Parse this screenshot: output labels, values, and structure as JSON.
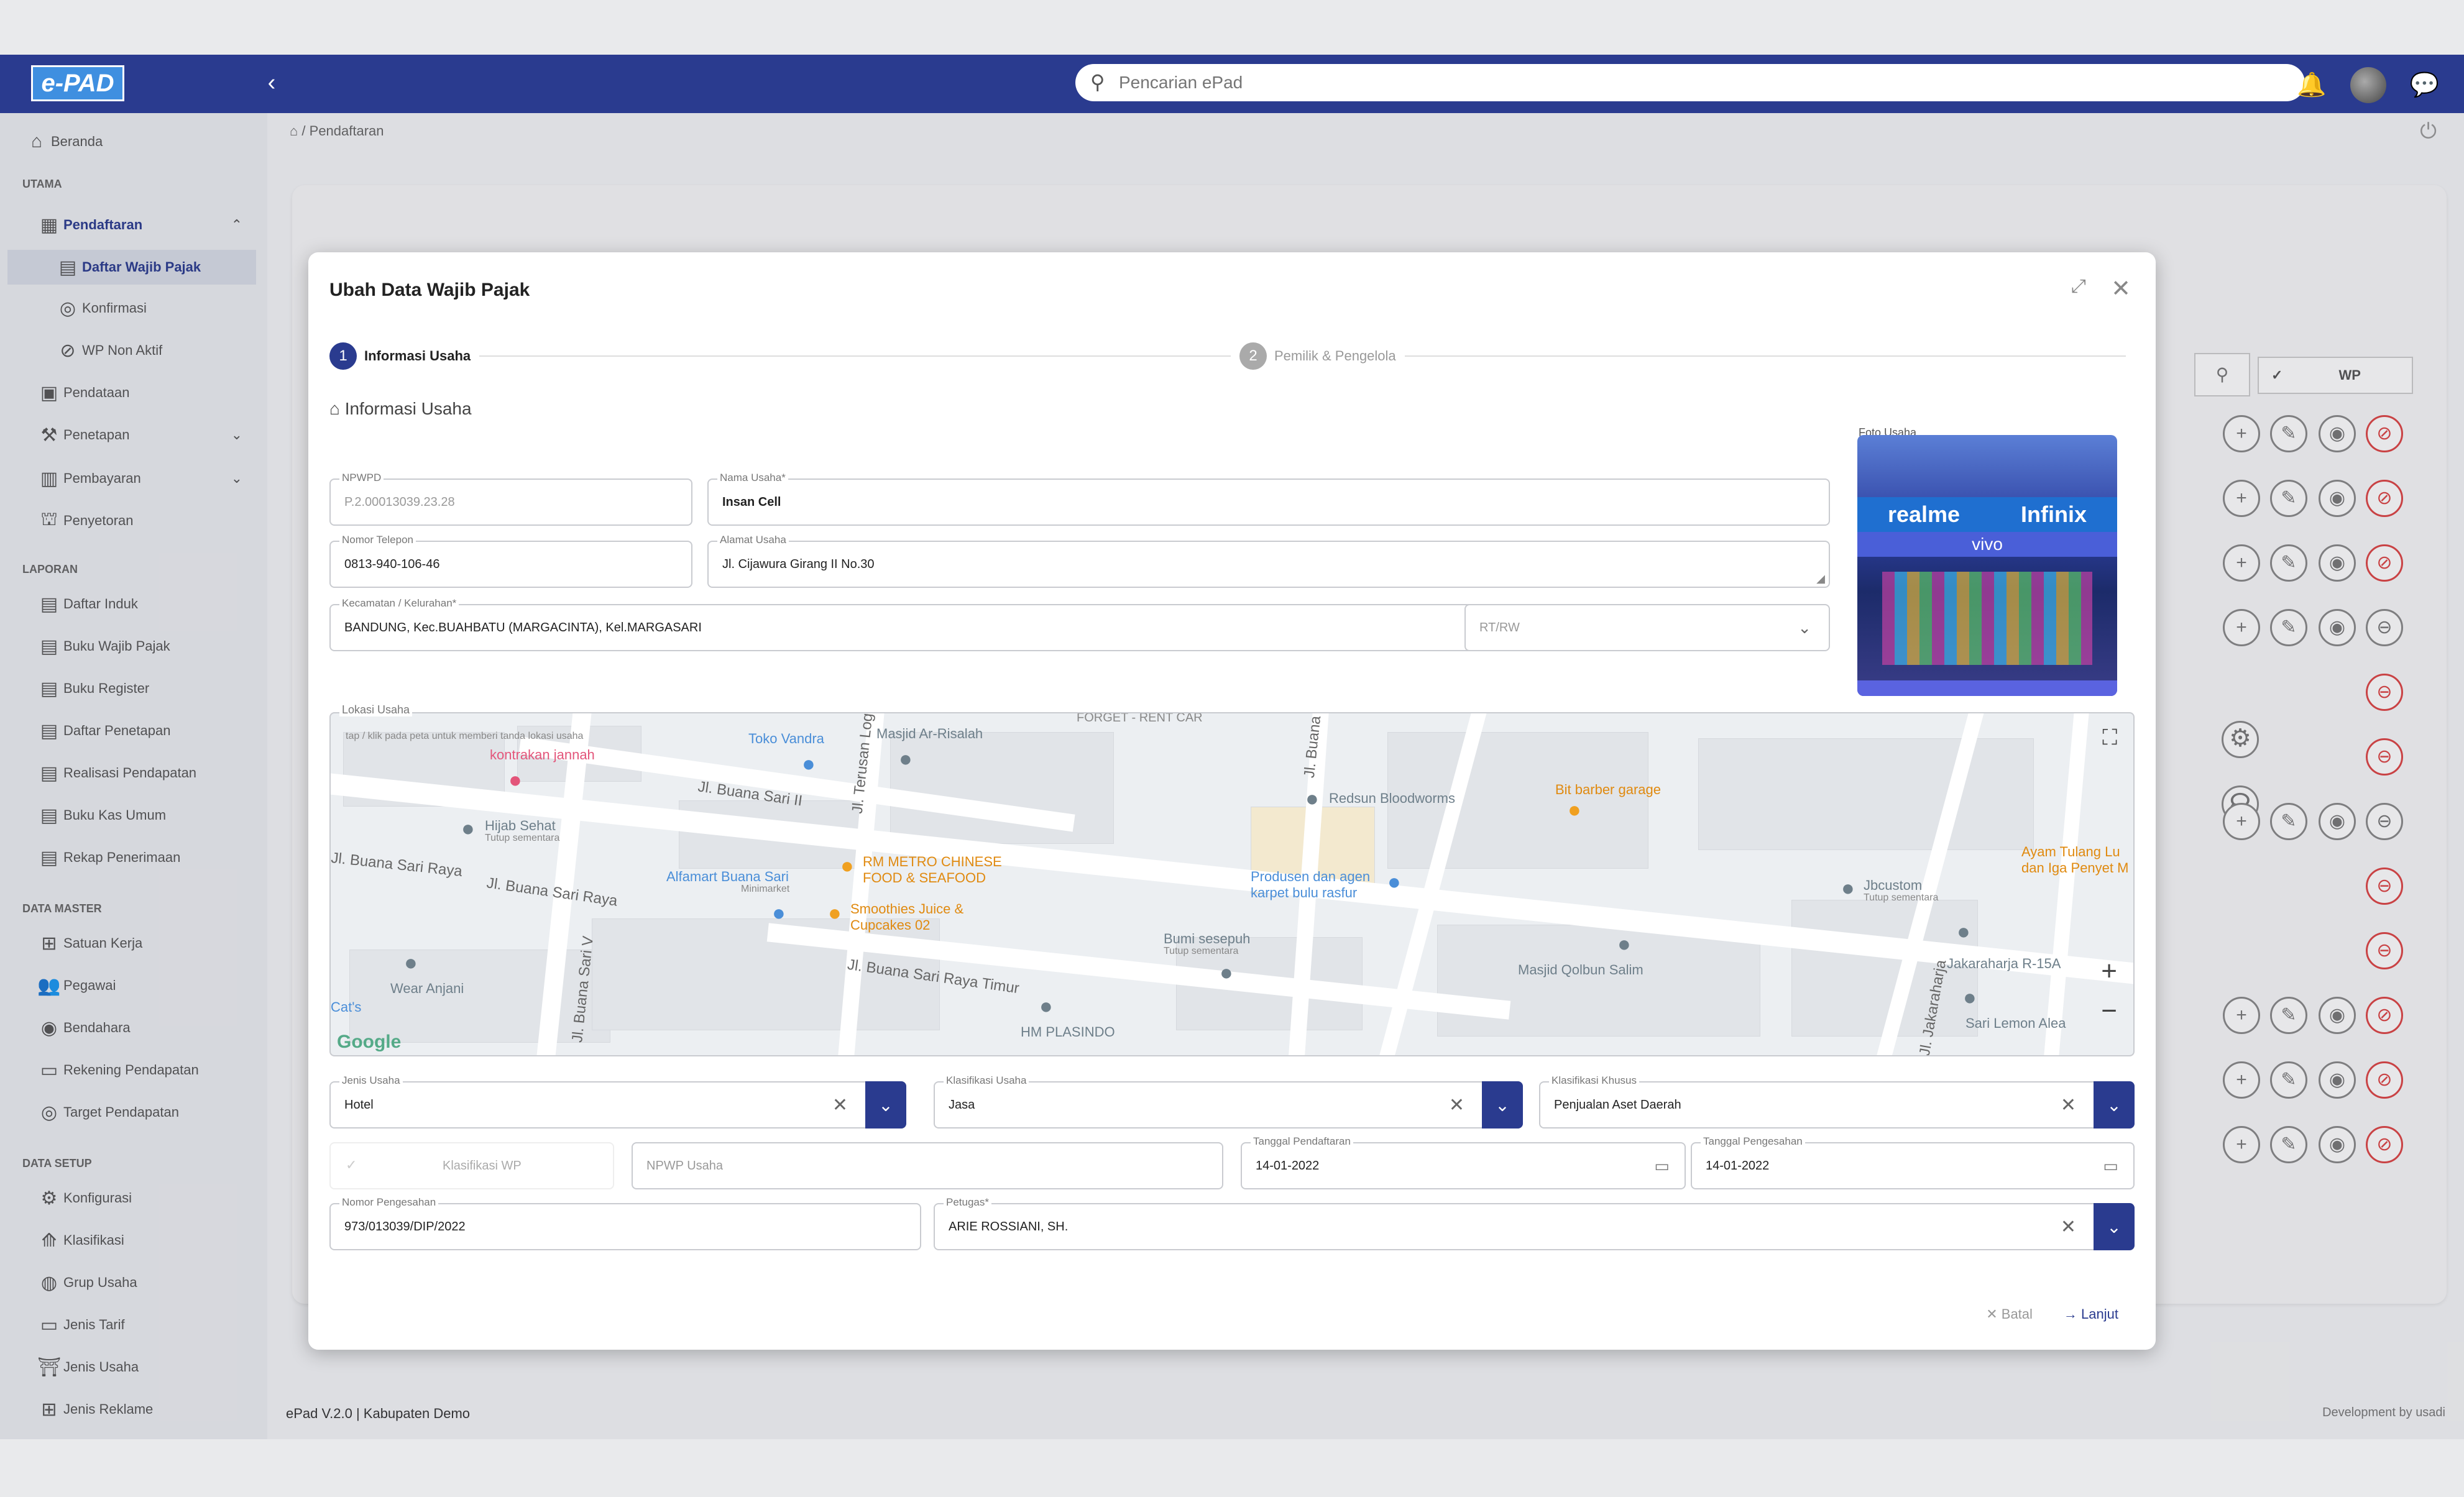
{
  "app": {
    "logo": "e-PAD",
    "search_placeholder": "Pencarian ePad"
  },
  "topbar": {
    "collapse": "‹",
    "bell": "🔔",
    "chat": "💬"
  },
  "sidebar": {
    "home": "Beranda",
    "sec_utama": "UTAMA",
    "pendaftaran": "Pendaftaran",
    "daftar_wajib_pajak": "Daftar Wajib Pajak",
    "konfirmasi": "Konfirmasi",
    "wp_non_aktif": "WP Non Aktif",
    "pendataan": "Pendataan",
    "penetapan": "Penetapan",
    "pembayaran": "Pembayaran",
    "penyetoran": "Penyetoran",
    "sec_laporan": "LAPORAN",
    "daftar_induk": "Daftar Induk",
    "buku_wajib_pajak": "Buku Wajib Pajak",
    "buku_register": "Buku Register",
    "daftar_penetapan": "Daftar Penetapan",
    "realisasi_pendapatan": "Realisasi Pendapatan",
    "buku_kas_umum": "Buku Kas Umum",
    "rekap_penerimaan": "Rekap Penerimaan",
    "sec_data_master": "DATA MASTER",
    "satuan_kerja": "Satuan Kerja",
    "pegawai": "Pegawai",
    "bendahara": "Bendahara",
    "rekening_pendapatan": "Rekening Pendapatan",
    "target_pendapatan": "Target Pendapatan",
    "sec_data_setup": "DATA SETUP",
    "konfigurasi": "Konfigurasi",
    "klasifikasi": "Klasifikasi",
    "grup_usaha": "Grup Usaha",
    "jenis_tarif": "Jenis Tarif",
    "jenis_usaha": "Jenis Usaha",
    "jenis_reklame": "Jenis Reklame"
  },
  "breadcrumb": "Pendaftaran",
  "background": {
    "wp_label": "WP"
  },
  "footer": {
    "version": "ePad V.2.0 | Kabupaten Demo",
    "dev": "Development by usadi"
  },
  "modal": {
    "title": "Ubah Data Wajib Pajak",
    "step1_num": "1",
    "step1": "Informasi Usaha",
    "step2_num": "2",
    "step2": "Pemilik & Pengelola",
    "section_title": "Informasi Usaha",
    "npwpd": {
      "label": "NPWPD",
      "value": "P.2.00013039.23.28"
    },
    "nama_usaha": {
      "label": "Nama Usaha*",
      "value": "Insan Cell"
    },
    "nomor_telepon": {
      "label": "Nomor Telepon",
      "value": "0813-940-106-46"
    },
    "alamat_usaha": {
      "label": "Alamat Usaha",
      "value": "Jl. Cijawura Girang II No.30"
    },
    "kecamatan": {
      "label": "Kecamatan / Kelurahan*",
      "value": "BANDUNG, Kec.BUAHBATU (MARGACINTA), Kel.MARGASARI"
    },
    "rt_rw": {
      "placeholder": "RT/RW"
    },
    "foto_label": "Foto Usaha",
    "photo_signs": {
      "realme": "realme",
      "infinix": "Infinix",
      "vivo": "vivo"
    },
    "lokasi_label": "Lokasi Usaha",
    "map": {
      "hint": "tap / klik pada peta untuk memberi tanda lokasi usaha",
      "places": {
        "kontrakan": "kontrakan jannah",
        "toko_vandra": "Toko Vandra",
        "masjid_ar": "Masjid Ar-Risalah",
        "forget_rent": "FORGET - RENT CAR",
        "redsun": "Redsun Bloodworms",
        "bit_barber": "Bit barber garage",
        "hijab": "Hijab Sehat",
        "hijab_sub": "Tutup sementara",
        "alfamart": "Alfamart Buana Sari",
        "alfamart_sub": "Minimarket",
        "rm_metro": "RM METRO CHINESE FOOD & SEAFOOD",
        "smoothies": "Smoothies Juice & Cupcakes 02",
        "produsen": "Produsen dan agen karpet bulu rasfur",
        "bumi": "Bumi sesepuh",
        "bumi_sub": "Tutup sementara",
        "masjid_qolbun": "Masjid Qolbun Salim",
        "jbcustom": "Jbcustom",
        "jbcustom_sub": "Tutup sementara",
        "ayam": "Ayam Tulang Lu dan Iga Penyet M",
        "jakarta": "Jakaraharja R-15A",
        "sari_lemon": "Sari Lemon Alea",
        "hm": "HM PLASINDO",
        "wear": "Wear Anjani",
        "cats": "Cat's"
      },
      "streets": {
        "s1": "Jl. Buana Sari II",
        "s2": "Jl. Buana Sari Raya",
        "s3": "Jl. Buana Sari Raya",
        "s4": "Jl. Buana Sari Raya Timur",
        "s5": "Jl. Buana Sari V",
        "s6": "Jl. Terusan Logam",
        "s7": "Jl. Buana",
        "s8": "Jl. Jakaraharja"
      },
      "google": "Google",
      "zoom_in": "+",
      "zoom_out": "−",
      "fullscreen": "⛶"
    },
    "jenis_usaha": {
      "label": "Jenis Usaha",
      "value": "Hotel"
    },
    "klasifikasi_usaha": {
      "label": "Klasifikasi Usaha",
      "value": "Jasa"
    },
    "klasifikasi_khusus": {
      "label": "Klasifikasi Khusus",
      "value": "Penjualan Aset Daerah"
    },
    "klasifikasi_wp": {
      "value": "Klasifikasi WP"
    },
    "npwp_usaha": {
      "placeholder": "NPWP Usaha"
    },
    "tgl_pendaftaran": {
      "label": "Tanggal Pendaftaran",
      "value": "14-01-2022"
    },
    "tgl_pengesahan": {
      "label": "Tanggal Pengesahan",
      "value": "14-01-2022"
    },
    "nomor_pengesahan": {
      "label": "Nomor Pengesahan",
      "value": "973/013039/DIP/2022"
    },
    "petugas": {
      "label": "Petugas*",
      "value": "ARIE ROSSIANI, SH."
    },
    "batal": "Batal",
    "lanjut": "Lanjut"
  }
}
